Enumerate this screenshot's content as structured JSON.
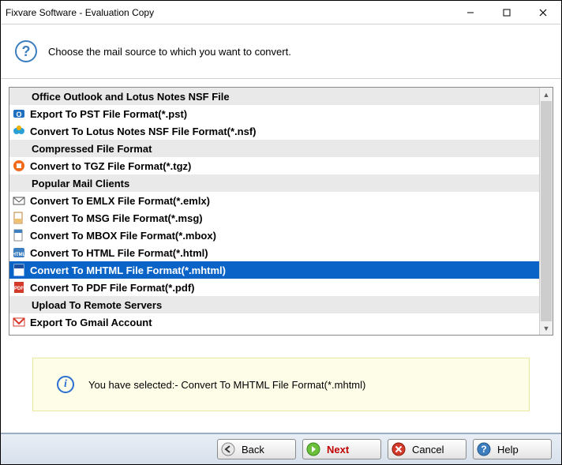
{
  "window": {
    "title": "Fixvare Software - Evaluation Copy"
  },
  "header": {
    "prompt": "Choose the mail source to which you want to convert."
  },
  "list": {
    "rows": [
      {
        "type": "category",
        "label": "Office Outlook and Lotus Notes NSF File"
      },
      {
        "type": "item",
        "icon": "outlook",
        "label": "Export To PST File Format(*.pst)"
      },
      {
        "type": "item",
        "icon": "nsf",
        "label": "Convert To Lotus Notes NSF File Format(*.nsf)"
      },
      {
        "type": "category",
        "label": "Compressed File Format"
      },
      {
        "type": "item",
        "icon": "tgz",
        "label": "Convert to TGZ File Format(*.tgz)"
      },
      {
        "type": "category",
        "label": "Popular Mail Clients"
      },
      {
        "type": "item",
        "icon": "emlx",
        "label": "Convert To EMLX File Format(*.emlx)"
      },
      {
        "type": "item",
        "icon": "msg",
        "label": "Convert To MSG File Format(*.msg)"
      },
      {
        "type": "item",
        "icon": "mbox",
        "label": "Convert To MBOX File Format(*.mbox)"
      },
      {
        "type": "item",
        "icon": "html",
        "label": "Convert To HTML File Format(*.html)"
      },
      {
        "type": "item",
        "icon": "mhtml",
        "label": "Convert To MHTML File Format(*.mhtml)",
        "selected": true
      },
      {
        "type": "item",
        "icon": "pdf",
        "label": "Convert To PDF File Format(*.pdf)"
      },
      {
        "type": "category",
        "label": "Upload To Remote Servers"
      },
      {
        "type": "item",
        "icon": "gmail",
        "label": "Export To Gmail Account"
      }
    ]
  },
  "info": {
    "text": "You have selected:- Convert To MHTML File Format(*.mhtml)"
  },
  "footer": {
    "back": "Back",
    "next": "Next",
    "cancel": "Cancel",
    "help": "Help"
  }
}
